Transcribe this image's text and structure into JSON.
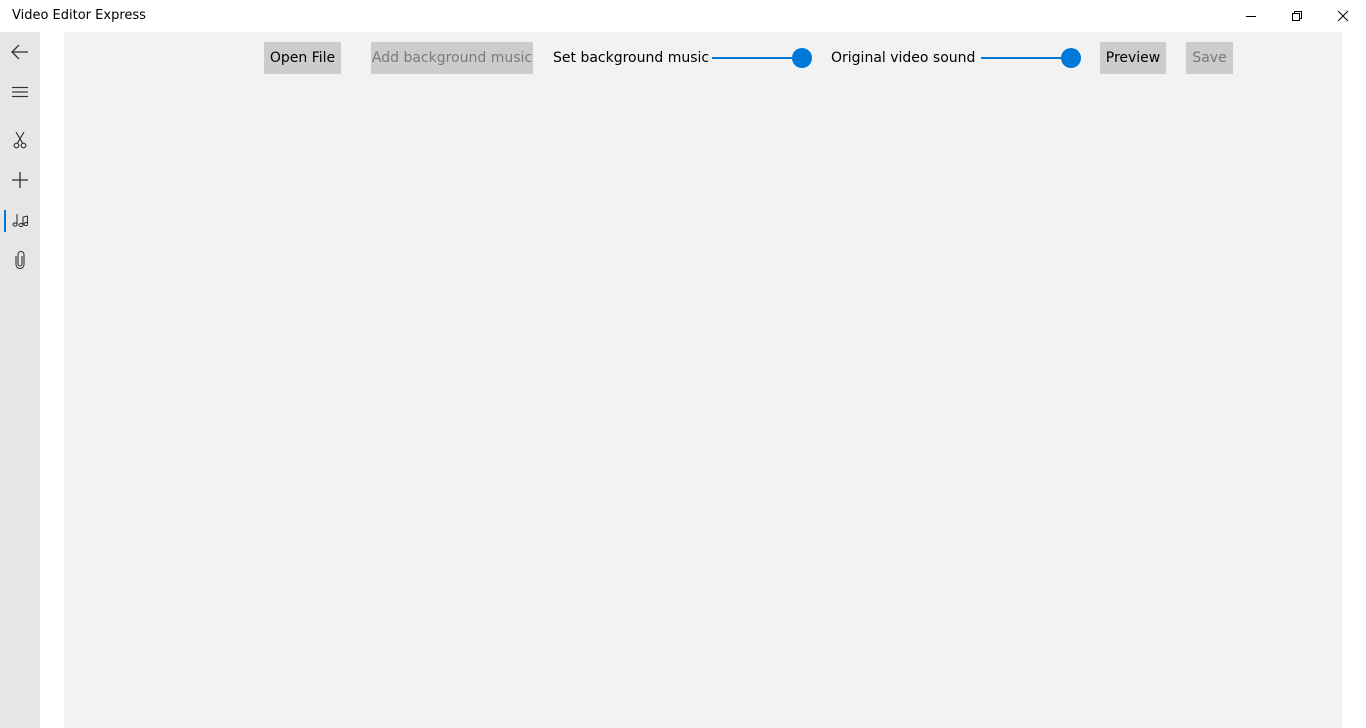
{
  "window": {
    "title": "Video Editor Express"
  },
  "sidebar": {
    "items": [
      {
        "icon": "back-arrow-icon"
      },
      {
        "icon": "hamburger-menu-icon"
      },
      {
        "icon": "scissors-icon"
      },
      {
        "icon": "plus-icon"
      },
      {
        "icon": "music-notes-icon",
        "selected": true
      },
      {
        "icon": "paperclip-icon"
      }
    ]
  },
  "toolbar": {
    "open_file_label": "Open File",
    "add_music_label": "Add background music",
    "bg_music_label": "Set background music",
    "bg_music_level": 1.0,
    "original_sound_label": "Original video sound",
    "original_sound_level": 1.0,
    "preview_label": "Preview",
    "save_label": "Save"
  },
  "colors": {
    "accent": "#0078d7",
    "sidebar_bg": "#e6e6e6",
    "content_bg": "#f2f2f2",
    "button_bg": "#cccccc"
  }
}
